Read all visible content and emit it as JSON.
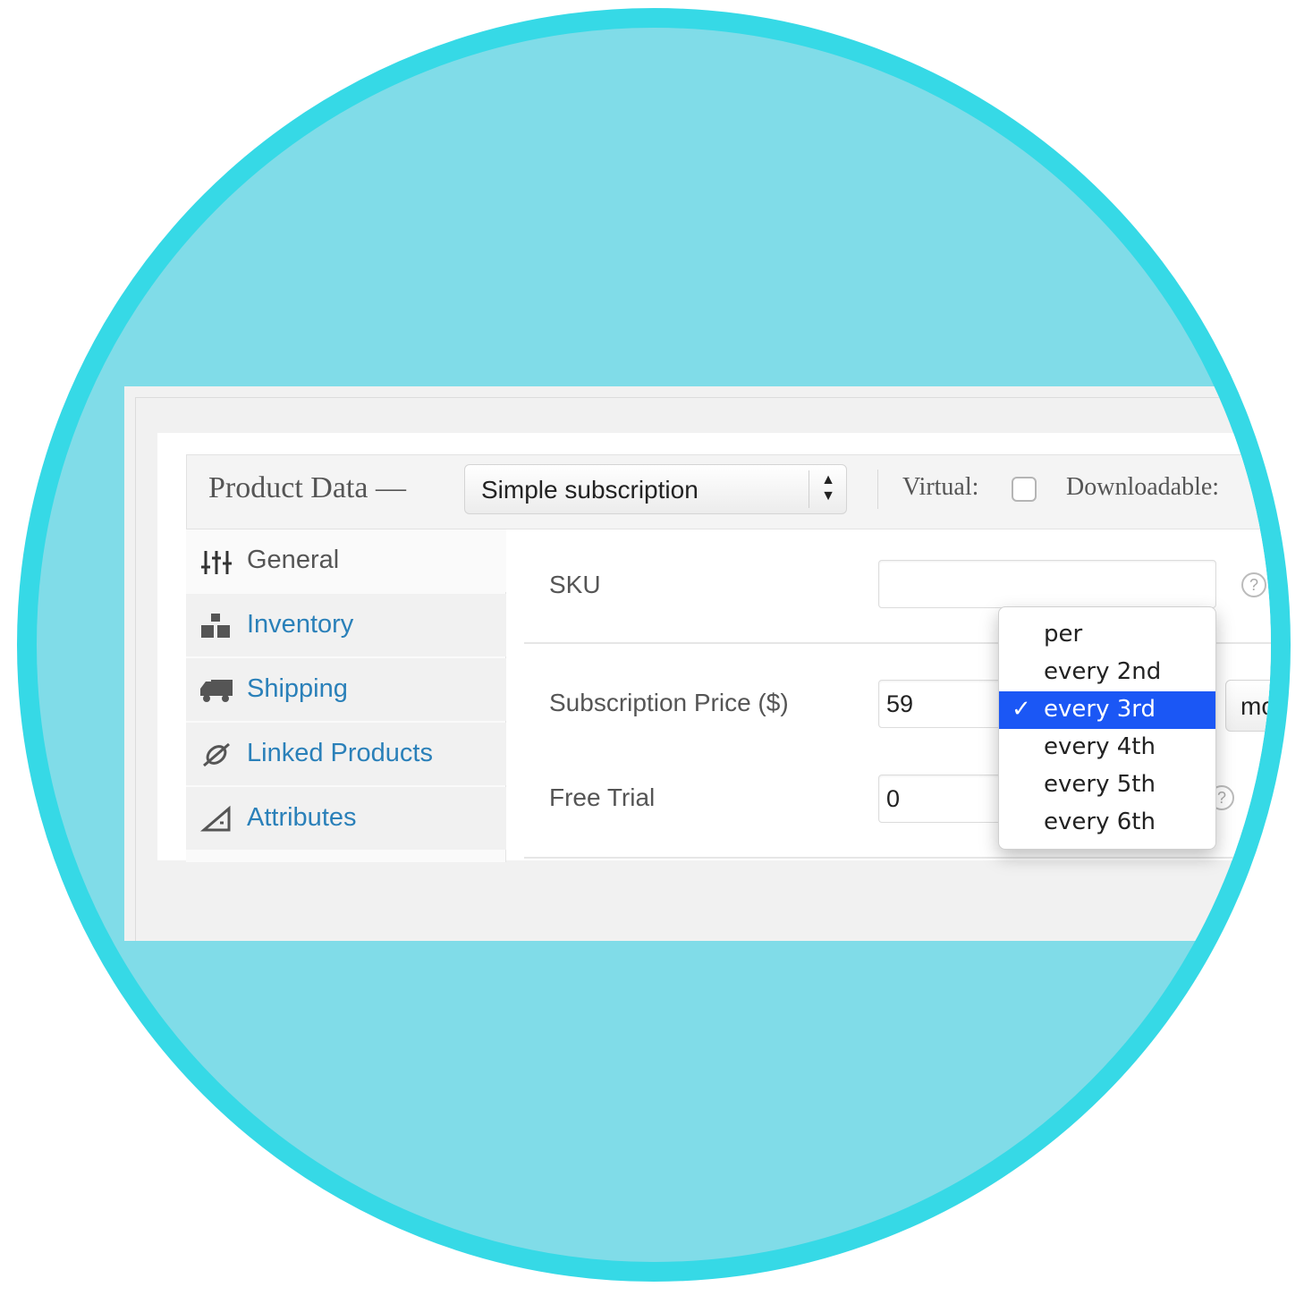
{
  "header": {
    "title": "Product Data —",
    "product_type": "Simple subscription",
    "virtual_label": "Virtual:",
    "downloadable_label": "Downloadable:"
  },
  "tabs": [
    {
      "label": "General",
      "icon": "sliders-icon",
      "active": true
    },
    {
      "label": "Inventory",
      "icon": "boxes-icon",
      "active": false
    },
    {
      "label": "Shipping",
      "icon": "truck-icon",
      "active": false
    },
    {
      "label": "Linked Products",
      "icon": "link-icon",
      "active": false
    },
    {
      "label": "Attributes",
      "icon": "ruler-triangle-icon",
      "active": false
    }
  ],
  "fields": {
    "sku_label": "SKU",
    "sku_value": "",
    "price_label": "Subscription Price ($)",
    "price_value": "59",
    "trial_label": "Free Trial",
    "trial_value": "0",
    "period_partial": "mon"
  },
  "interval_dropdown": {
    "options": [
      "per",
      "every 2nd",
      "every 3rd",
      "every 4th",
      "every 5th",
      "every 6th"
    ],
    "selected_index": 2,
    "check": "✓"
  },
  "colors": {
    "circle_fill": "#80dce8",
    "circle_border": "#36d9e6",
    "link": "#2a80b9",
    "selection": "#1b57f5"
  }
}
